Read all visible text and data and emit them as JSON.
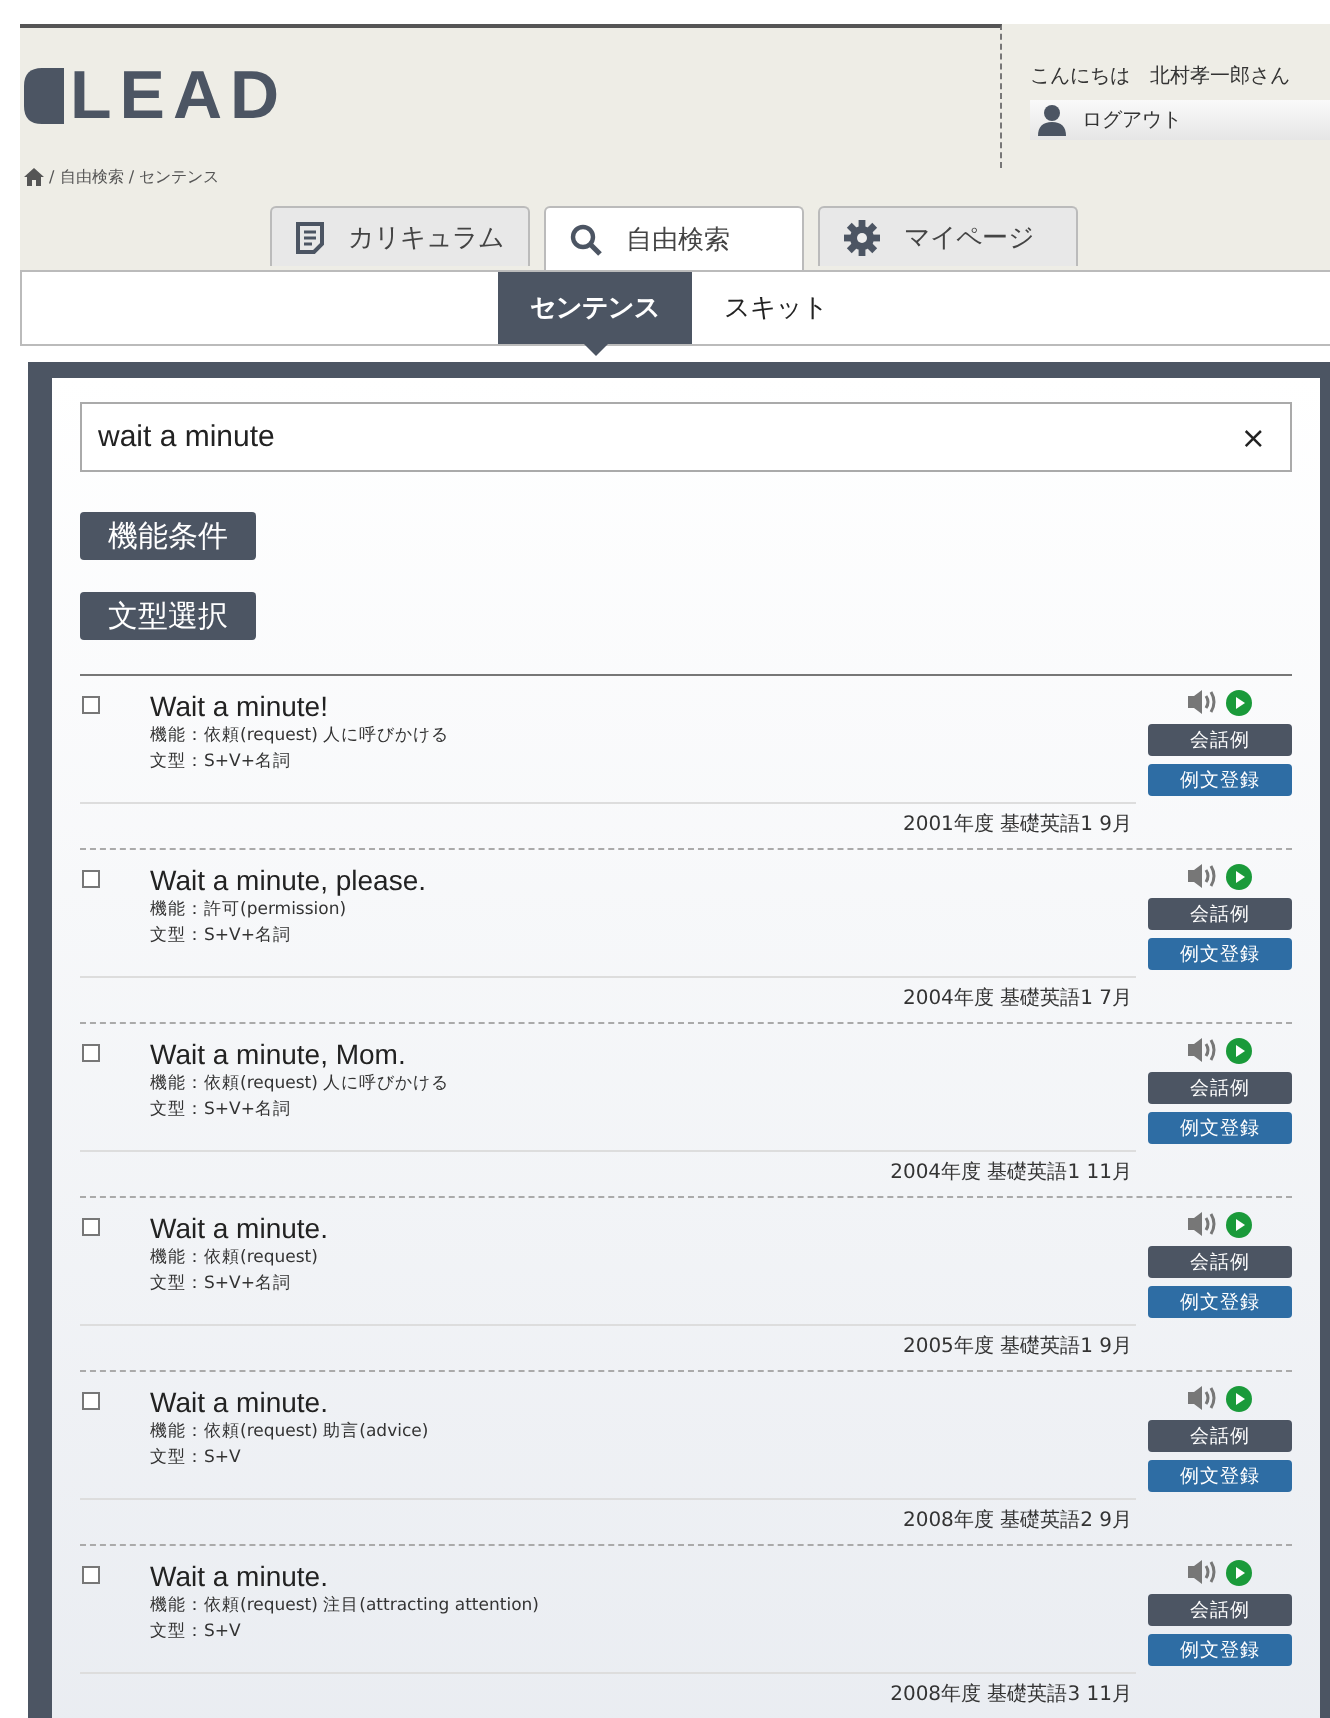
{
  "logo": "LEAD",
  "user": {
    "greeting": "こんにちは　北村孝一郎さん",
    "logout": "ログアウト"
  },
  "breadcrumb": [
    "/ 自由検索",
    "/ センテンス"
  ],
  "tabs": [
    {
      "label": "カリキュラム",
      "selected": false
    },
    {
      "label": "自由検索",
      "selected": true
    },
    {
      "label": "マイページ",
      "selected": false
    }
  ],
  "subtabs": [
    {
      "label": "センテンス",
      "selected": true
    },
    {
      "label": "スキット",
      "selected": false
    }
  ],
  "search": {
    "value": "wait a minute",
    "clear": "×"
  },
  "filters": [
    "機能条件",
    "文型選択"
  ],
  "results": [
    {
      "checked": false,
      "sentence": "Wait a minute!",
      "function_label": "機能：",
      "function": "依頼(request) 人に呼びかける",
      "pattern_label": "文型：",
      "pattern": "S+V+名詞",
      "source": "2001年度 基礎英語1 9月",
      "dialog_button": "会話例",
      "register_button": "例文登録"
    },
    {
      "checked": false,
      "sentence": "Wait a minute, please.",
      "function_label": "機能：",
      "function": "許可(permission)",
      "pattern_label": "文型：",
      "pattern": "S+V+名詞",
      "source": "2004年度 基礎英語1 7月",
      "dialog_button": "会話例",
      "register_button": "例文登録"
    },
    {
      "checked": false,
      "sentence": "Wait a minute, Mom.",
      "function_label": "機能：",
      "function": "依頼(request) 人に呼びかける",
      "pattern_label": "文型：",
      "pattern": "S+V+名詞",
      "source": "2004年度 基礎英語1 11月",
      "dialog_button": "会話例",
      "register_button": "例文登録"
    },
    {
      "checked": false,
      "sentence": "Wait a minute.",
      "function_label": "機能：",
      "function": "依頼(request)",
      "pattern_label": "文型：",
      "pattern": "S+V+名詞",
      "source": "2005年度 基礎英語1 9月",
      "dialog_button": "会話例",
      "register_button": "例文登録"
    },
    {
      "checked": false,
      "sentence": "Wait a minute.",
      "function_label": "機能：",
      "function": "依頼(request) 助言(advice)",
      "pattern_label": "文型：",
      "pattern": "S+V",
      "source": "2008年度 基礎英語2 9月",
      "dialog_button": "会話例",
      "register_button": "例文登録"
    },
    {
      "checked": false,
      "sentence": "Wait a minute.",
      "function_label": "機能：",
      "function": "依頼(request) 注目(attracting attention)",
      "pattern_label": "文型：",
      "pattern": "S+V",
      "source": "2008年度 基礎英語3 11月",
      "dialog_button": "会話例",
      "register_button": "例文登録"
    }
  ]
}
